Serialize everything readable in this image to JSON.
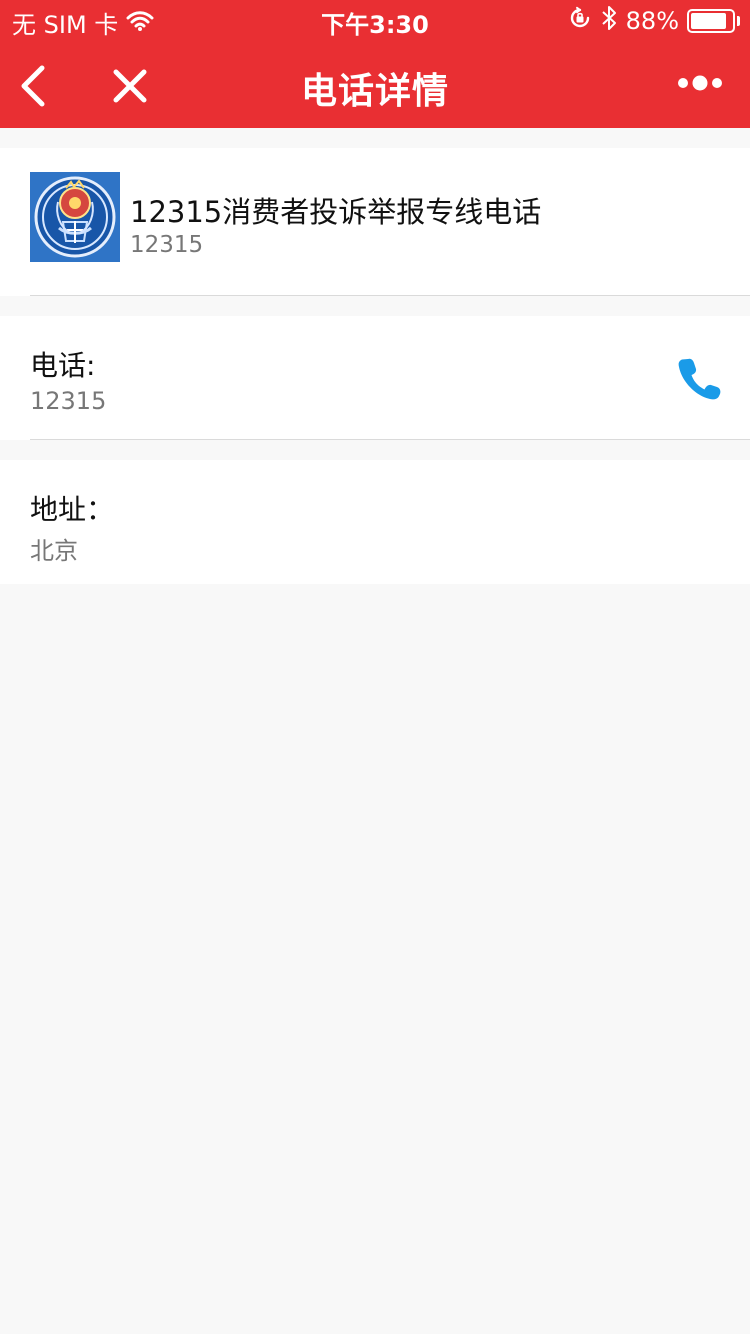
{
  "status_bar": {
    "carrier": "无 SIM 卡",
    "time": "下午3:30",
    "battery_percent": "88%",
    "battery_level": 0.88,
    "icons": [
      "wifi-icon",
      "orientation-lock-icon",
      "bluetooth-icon",
      "battery-icon"
    ]
  },
  "nav": {
    "title": "电话详情",
    "icons": [
      "back-arrow-icon",
      "close-icon",
      "more-dots-icon"
    ]
  },
  "contact": {
    "name": "12315消费者投诉举报专线电话",
    "number": "12315",
    "avatar_icon": "government-emblem-icon"
  },
  "phone": {
    "label": "电话:",
    "value": "12315",
    "call_icon": "phone-call-icon"
  },
  "address": {
    "label": "地址：",
    "value": "北京"
  },
  "colors": {
    "header": "#e92f33",
    "accent": "#1a9be8",
    "background": "#f8f8f8",
    "secondary_text": "#777777"
  }
}
